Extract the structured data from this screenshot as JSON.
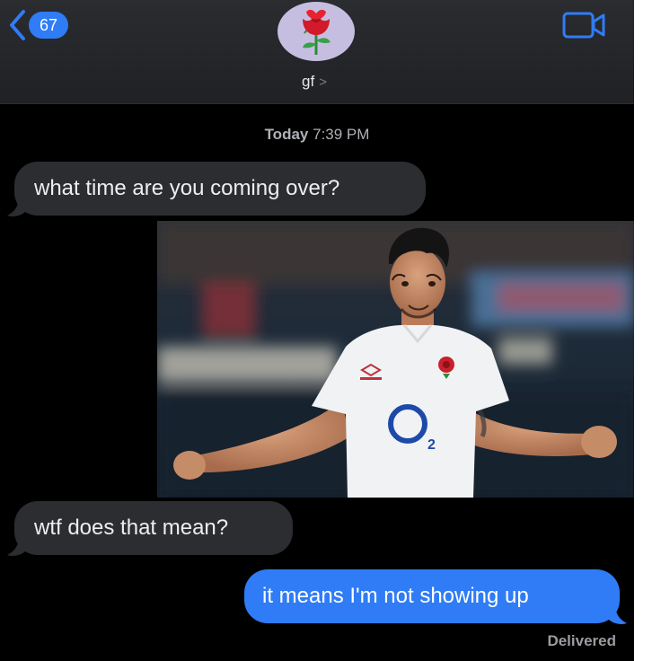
{
  "header": {
    "back_count": "67",
    "contact_name": "gf",
    "contact_chevron": ">",
    "avatar_emoji": "rose",
    "video_icon": "video-camera-icon",
    "back_icon": "chevron-left-icon"
  },
  "conversation": {
    "timestamp_day": "Today",
    "timestamp_time": "7:39 PM",
    "messages": [
      {
        "direction": "incoming",
        "type": "text",
        "text": "what time are you coming over?"
      },
      {
        "direction": "outgoing",
        "type": "image",
        "image_subject": "rugby player in white jersey shrugging"
      },
      {
        "direction": "incoming",
        "type": "text",
        "text": "wtf does that mean?"
      },
      {
        "direction": "outgoing",
        "type": "text",
        "text": "it means I'm not showing up"
      }
    ],
    "status": "Delivered"
  },
  "photo": {
    "jersey_brand": "umbro",
    "jersey_sponsor": "O",
    "jersey_sponsor_sub": "2"
  },
  "colors": {
    "accent_blue": "#2f7cf6",
    "incoming_bubble": "#2b2d31",
    "background": "#000000",
    "avatar_bg": "#c6bee0"
  }
}
